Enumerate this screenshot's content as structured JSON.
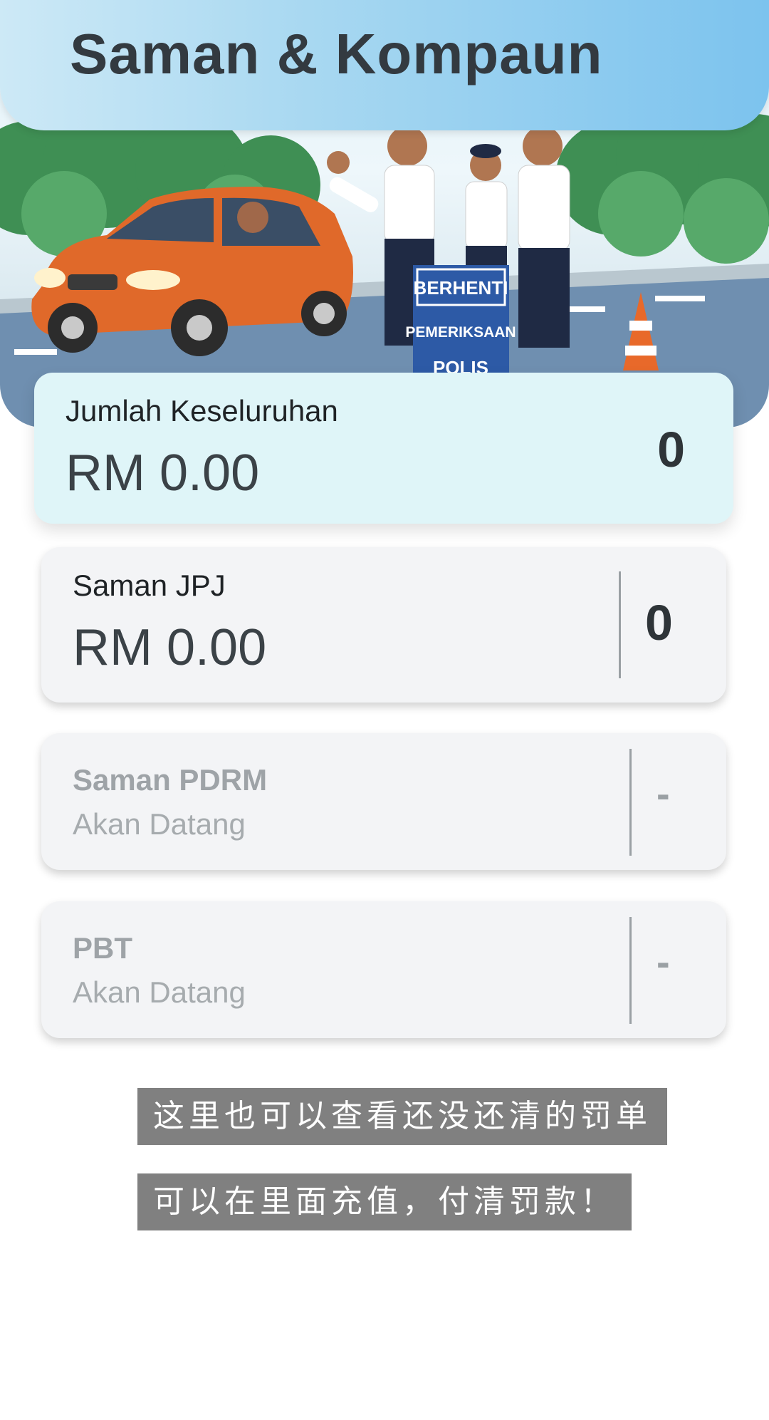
{
  "header": {
    "title": "Saman & Kompaun"
  },
  "hero": {
    "sign_lines": [
      "BERHENTI",
      "PEMERIKSAAN",
      "POLIS"
    ]
  },
  "summary": {
    "label": "Jumlah Keseluruhan",
    "amount": "RM 0.00",
    "count": "0"
  },
  "items": [
    {
      "label": "Saman JPJ",
      "amount": "RM 0.00",
      "count": "0"
    },
    {
      "label": "Saman PDRM",
      "status": "Akan Datang",
      "count": "-"
    },
    {
      "label": "PBT",
      "status": "Akan Datang",
      "count": "-"
    }
  ],
  "captions": [
    "这里也可以查看还没还清的罚单",
    "可以在里面充值，付清罚款！"
  ],
  "colors": {
    "header_gradient_start": "#cde9f6",
    "header_gradient_end": "#7cc3ee",
    "summary_card": "#dff5f8",
    "item_card": "#f3f4f6",
    "car": "#e0692a",
    "caption_bg": "#808080"
  }
}
